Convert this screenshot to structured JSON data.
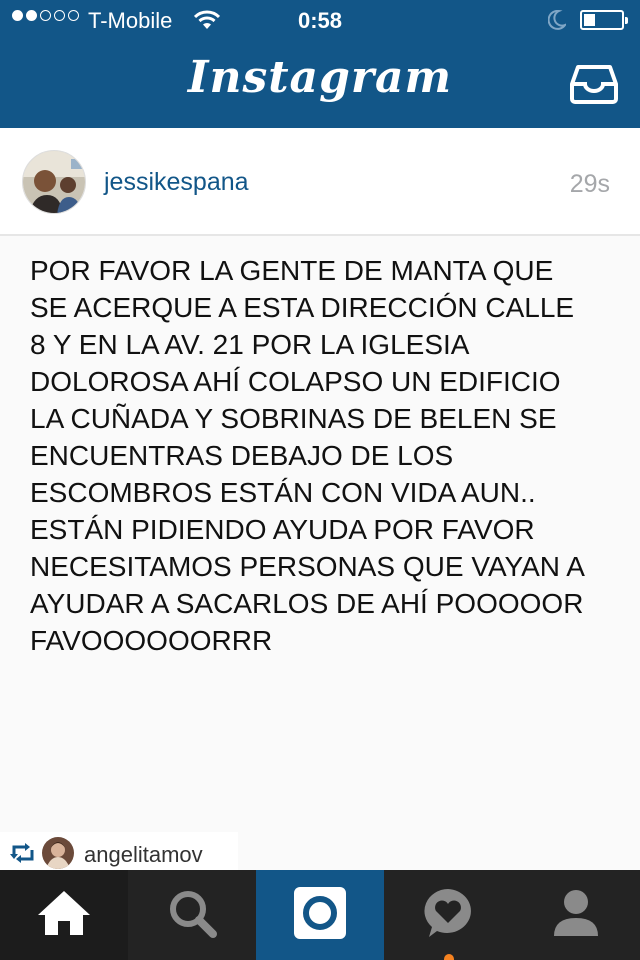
{
  "status_bar": {
    "carrier": "T-Mobile",
    "time": "0:58",
    "signal_bars_filled": 2,
    "signal_bars_total": 5,
    "battery_level": 0.3
  },
  "header": {
    "logo": "Instagram",
    "inbox_icon": "inbox-tray-icon"
  },
  "post": {
    "username": "jessikespana",
    "time_ago": "29s",
    "text": "POR FAVOR LA GENTE DE MANTA QUE\nSE ACERQUE A ESTA DIRECCIÓN CALLE\n8 Y EN LA AV. 21 POR LA IGLESIA\nDOLOROSA AHÍ COLAPSO UN EDIFICIO\nLA CUÑADA Y SOBRINAS DE BELEN SE\nENCUENTRAS DEBAJO DE LOS\nESCOMBROS ESTÁN CON VIDA AUN..\nESTÁN PIDIENDO AYUDA POR FAVOR\nNECESITAMOS PERSONAS QUE VAYAN A\nAYUDAR A SACARLOS DE AHÍ POOOOOR\nFAVOOOOOORRR"
  },
  "repost": {
    "username": "angelitamov",
    "icon": "repost-icon"
  },
  "tab_bar": {
    "tabs": [
      {
        "name": "home",
        "icon": "home-icon",
        "active": true
      },
      {
        "name": "search",
        "icon": "search-icon",
        "active": false
      },
      {
        "name": "camera",
        "icon": "camera-icon",
        "active": false
      },
      {
        "name": "activity",
        "icon": "activity-heart-icon",
        "active": false,
        "has_notification": true
      },
      {
        "name": "profile",
        "icon": "profile-icon",
        "active": false
      }
    ]
  },
  "colors": {
    "brand_blue": "#125688",
    "tab_bar": "#232323",
    "notification": "#f58220",
    "timestamp_gray": "#a5a7aa"
  }
}
